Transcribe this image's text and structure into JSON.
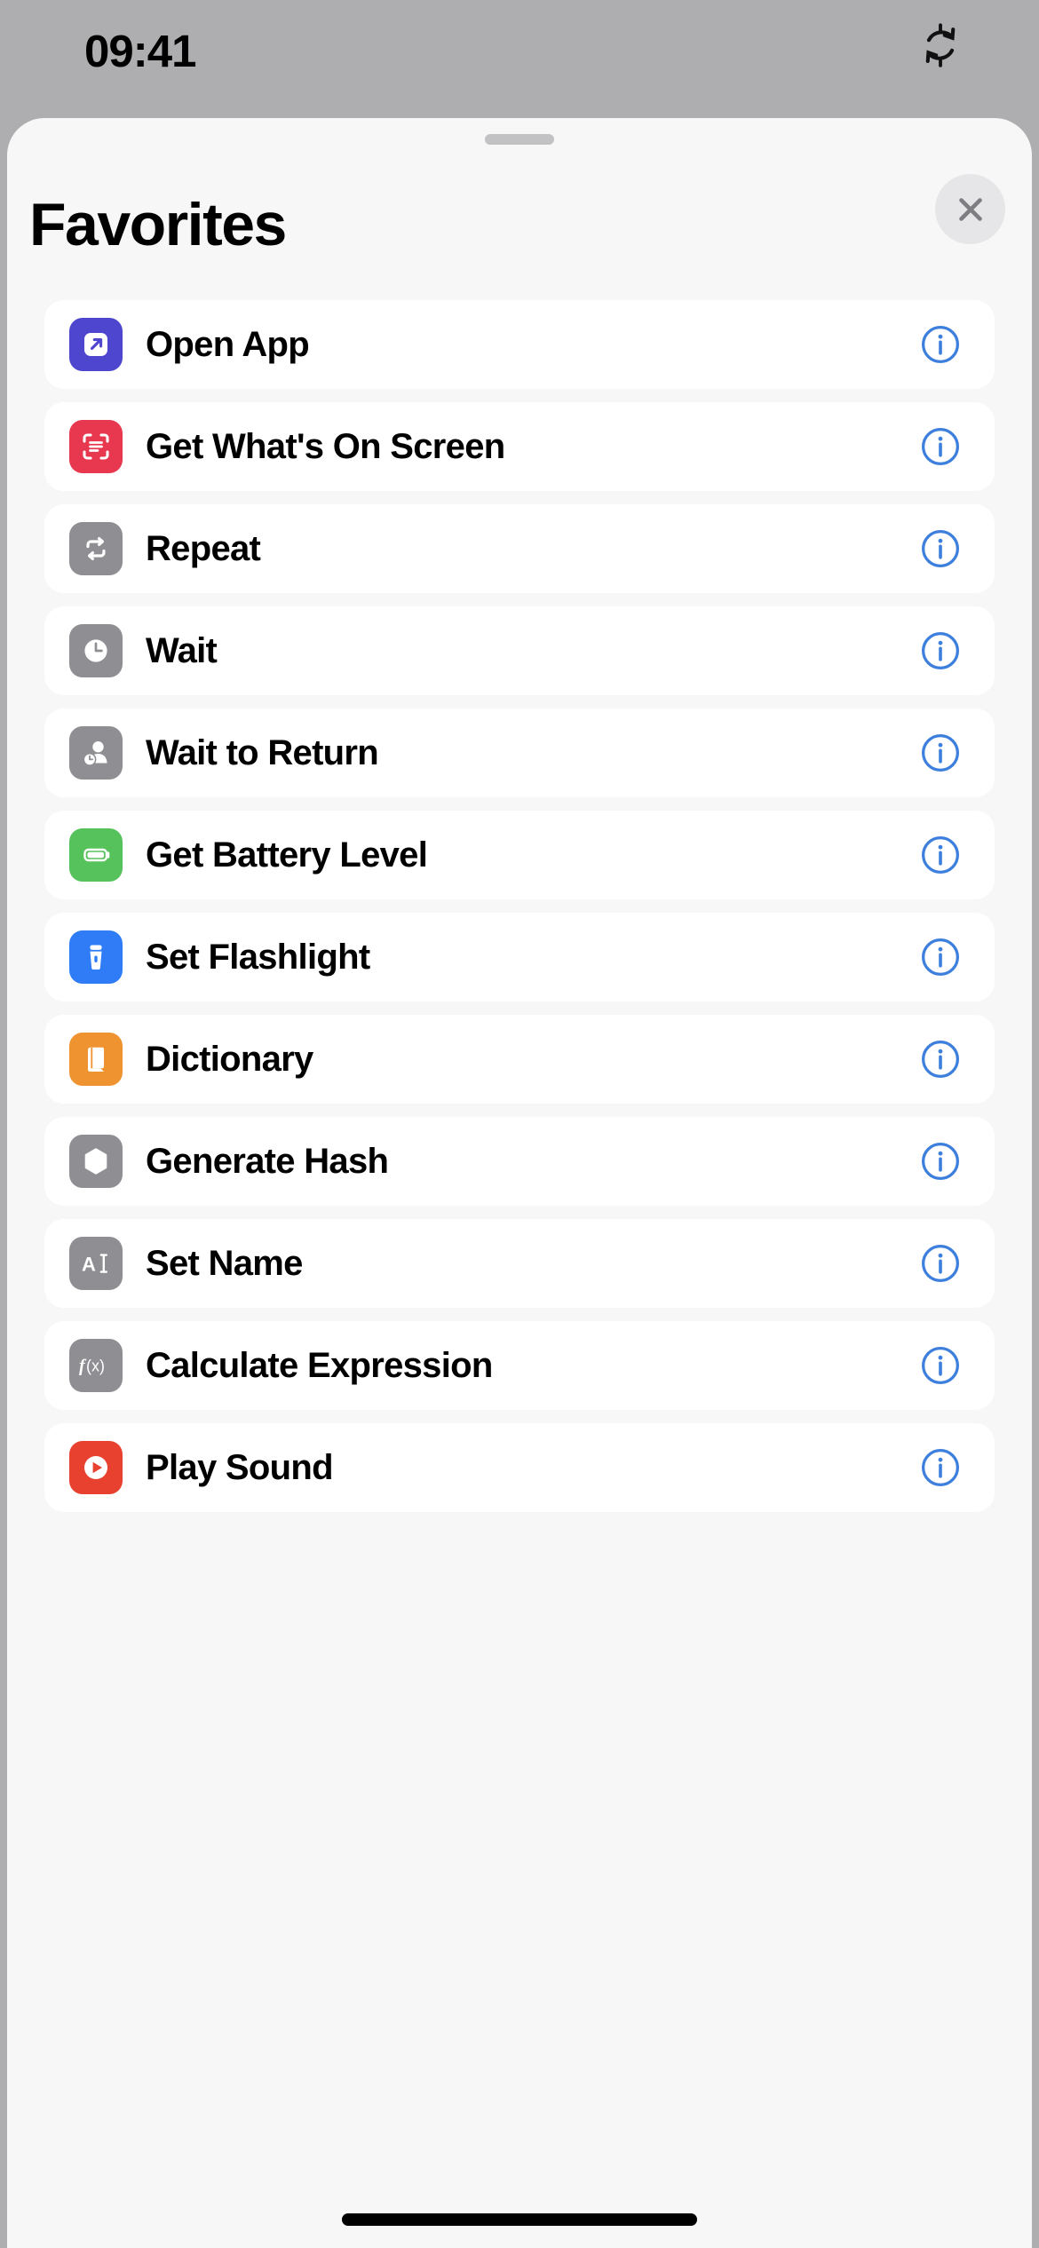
{
  "status_bar": {
    "time": "09:41",
    "right_icon": "sync-refresh-icon"
  },
  "sheet": {
    "title": "Favorites",
    "close_label": "close-icon",
    "grabber": "sheet-grabber"
  },
  "colors": {
    "background": "#aeaeb0",
    "sheet_background": "#f7f7f7",
    "row_background": "#ffffff",
    "info_blue": "#3d7fdc",
    "purple": "#4f46cf",
    "red_pink": "#e8384f",
    "gray": "#8e8e93",
    "green": "#56c25b",
    "blue": "#2f7cf6",
    "orange": "#ef9330",
    "red": "#e8412f",
    "close_bg": "#e6e6e8",
    "close_x": "#7d7d82"
  },
  "list": {
    "items": [
      {
        "label": "Open App",
        "icon": "open-app-icon",
        "icon_color": "#4f46cf",
        "info": "info-icon"
      },
      {
        "label": "Get What's On Screen",
        "icon": "scan-screen-icon",
        "icon_color": "#e8384f",
        "info": "info-icon"
      },
      {
        "label": "Repeat",
        "icon": "repeat-icon",
        "icon_color": "#8e8e93",
        "info": "info-icon"
      },
      {
        "label": "Wait",
        "icon": "clock-icon",
        "icon_color": "#8e8e93",
        "info": "info-icon"
      },
      {
        "label": "Wait to Return",
        "icon": "person-clock-icon",
        "icon_color": "#8e8e93",
        "info": "info-icon"
      },
      {
        "label": "Get Battery Level",
        "icon": "battery-icon",
        "icon_color": "#56c25b",
        "info": "info-icon"
      },
      {
        "label": "Set Flashlight",
        "icon": "flashlight-icon",
        "icon_color": "#2f7cf6",
        "info": "info-icon"
      },
      {
        "label": "Dictionary",
        "icon": "book-icon",
        "icon_color": "#ef9330",
        "info": "info-icon"
      },
      {
        "label": "Generate Hash",
        "icon": "hexagon-icon",
        "icon_color": "#8e8e93",
        "info": "info-icon"
      },
      {
        "label": "Set Name",
        "icon": "text-cursor-icon",
        "icon_color": "#8e8e93",
        "info": "info-icon"
      },
      {
        "label": "Calculate Expression",
        "icon": "function-icon",
        "icon_color": "#8e8e93",
        "info": "info-icon"
      },
      {
        "label": "Play Sound",
        "icon": "play-sound-icon",
        "icon_color": "#e8412f",
        "info": "info-icon"
      }
    ]
  }
}
